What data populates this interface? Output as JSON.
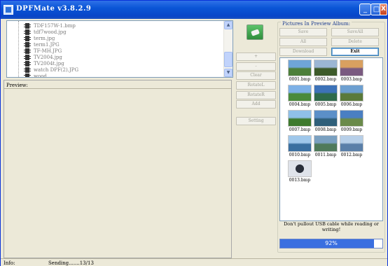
{
  "window": {
    "title": "DPFMate v3.8.2.9"
  },
  "titlebar_buttons": {
    "minimize": "_",
    "maximize": "□",
    "close": "X"
  },
  "file_list": {
    "items": [
      "TDF157W-1.bmp",
      "tdf7wood.jpg",
      "term.jpg",
      "term1.JPG",
      "TF-MH.JPG",
      "TV2004.jpg",
      "TV2004t.jpg",
      "watch DPF(2).JPG",
      "wood"
    ]
  },
  "scroll": {
    "up": "▲",
    "down": "▼"
  },
  "preview": {
    "label": "Preview:"
  },
  "middle_buttons": {
    "plus": "+",
    "minus": "-",
    "clear": "Clear",
    "rotate_l": "RotateL",
    "rotate_r": "RotateR",
    "add": "Add",
    "setting": "Setting"
  },
  "album": {
    "title": "Pictures In Preview Album:",
    "save": "Save",
    "save_all": "SaveAll",
    "all": "All",
    "delete": "Delete",
    "download": "Download",
    "exit": "Exit",
    "thumbnails": [
      {
        "name": "0001.bmp",
        "icon": "landscape-thumbnail",
        "c1": "#6fa5d8",
        "c2": "#4d7f3a"
      },
      {
        "name": "0002.bmp",
        "icon": "landscape-thumbnail",
        "c1": "#9bb6d4",
        "c2": "#3d5a2a"
      },
      {
        "name": "0003.bmp",
        "icon": "landscape-thumbnail",
        "c1": "#d9a060",
        "c2": "#7a5a80"
      },
      {
        "name": "0004.bmp",
        "icon": "landscape-thumbnail",
        "c1": "#7db0e6",
        "c2": "#4a8a3a"
      },
      {
        "name": "0005.bmp",
        "icon": "landscape-thumbnail",
        "c1": "#3d72b8",
        "c2": "#2e6a4a"
      },
      {
        "name": "0006.bmp",
        "icon": "landscape-thumbnail",
        "c1": "#6d9fd0",
        "c2": "#5a7a3a"
      },
      {
        "name": "0007.bmp",
        "icon": "landscape-thumbnail",
        "c1": "#8fc0e8",
        "c2": "#3e7a2e"
      },
      {
        "name": "0008.bmp",
        "icon": "landscape-thumbnail",
        "c1": "#5b8fc8",
        "c2": "#2f5f7a"
      },
      {
        "name": "0009.bmp",
        "icon": "landscape-thumbnail",
        "c1": "#4a7fc2",
        "c2": "#6a8a4a"
      },
      {
        "name": "0010.bmp",
        "icon": "landscape-thumbnail",
        "c1": "#9fc7ea",
        "c2": "#3a6fa0"
      },
      {
        "name": "0011.bmp",
        "icon": "landscape-thumbnail",
        "c1": "#7aa0c0",
        "c2": "#4f7a5a"
      },
      {
        "name": "0012.bmp",
        "icon": "landscape-thumbnail",
        "c1": "#b7cfe8",
        "c2": "#5a7fa8"
      },
      {
        "name": "0013.bmp",
        "icon": "watch-thumbnail",
        "c1": "#dfe3ea",
        "c2": "#2a2f3a"
      }
    ],
    "warning": "Don't pullout USB cable while reading or writing!",
    "progress": {
      "percent": 92,
      "label": "92%"
    }
  },
  "status": {
    "info_label": "Info:",
    "sending": "Sending.......13/13"
  }
}
